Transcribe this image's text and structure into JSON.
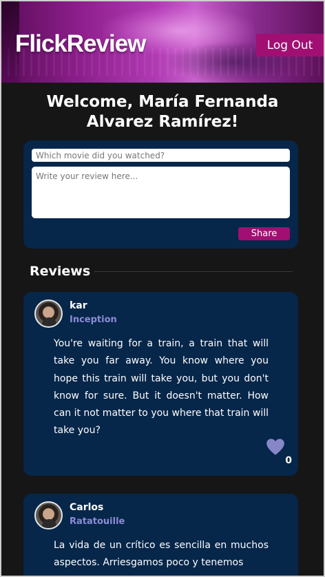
{
  "header": {
    "logo": "FlickReview",
    "logout_label": "Log Out"
  },
  "welcome": {
    "text": "Welcome, María Fernanda Alvarez Ramírez!"
  },
  "compose": {
    "movie_placeholder": "Which movie did you watched?",
    "review_placeholder": "Write your review here...",
    "share_label": "Share"
  },
  "reviews": {
    "heading": "Reviews",
    "items": [
      {
        "user": "kar",
        "movie": "Inception",
        "text": "You're waiting for a train, a train that will take you far away. You know where you hope this train will take you, but you don't know for sure. But it doesn't matter. How can it not matter to you where that train will take you?",
        "likes": "0",
        "icon": "heart-icon"
      },
      {
        "user": "Carlos",
        "movie": "Ratatouille",
        "text": "La vida de un crítico es sencilla en muchos aspectos. Arriesgamos poco y tenemos",
        "icon": "heart-icon"
      }
    ]
  },
  "colors": {
    "accent": "#a20f73",
    "card": "#06264a",
    "background": "#161616",
    "movie_link": "#8c8cd6",
    "heart": "#8787c8"
  }
}
